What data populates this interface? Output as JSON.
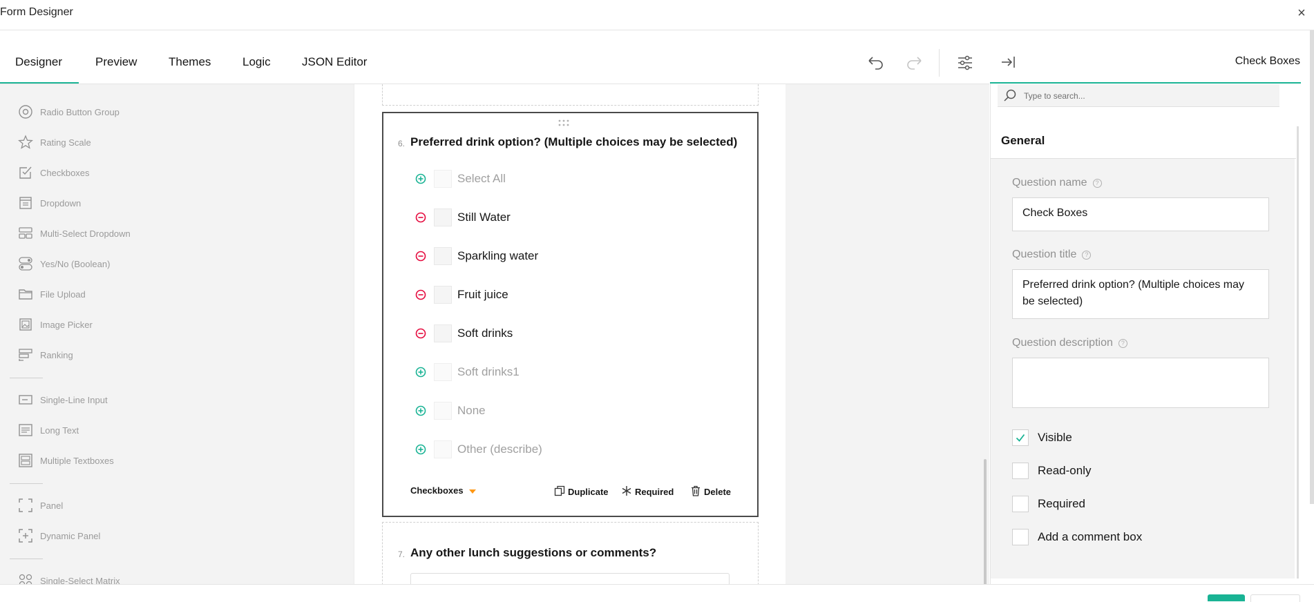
{
  "window": {
    "title": "Form Designer",
    "close_glyph": "×"
  },
  "tabs": [
    {
      "label": "Designer",
      "active": true
    },
    {
      "label": "Preview"
    },
    {
      "label": "Themes"
    },
    {
      "label": "Logic"
    },
    {
      "label": "JSON Editor"
    }
  ],
  "toolbar_icons": [
    "undo-icon",
    "redo-icon",
    "settings-sliders-icon"
  ],
  "toolbox": {
    "items": [
      {
        "label": "Radio Button Group",
        "icon": "radio-button-icon"
      },
      {
        "label": "Rating Scale",
        "icon": "star-icon"
      },
      {
        "label": "Checkboxes",
        "icon": "checkbox-icon"
      },
      {
        "label": "Dropdown",
        "icon": "dropdown-icon"
      },
      {
        "label": "Multi-Select Dropdown",
        "icon": "multi-select-icon"
      },
      {
        "label": "Yes/No (Boolean)",
        "icon": "toggle-icon"
      },
      {
        "label": "File Upload",
        "icon": "folder-icon"
      },
      {
        "label": "Image Picker",
        "icon": "image-icon"
      },
      {
        "label": "Ranking",
        "icon": "ranking-icon"
      },
      {
        "label": "Single-Line Input",
        "icon": "single-line-icon"
      },
      {
        "label": "Long Text",
        "icon": "long-text-icon"
      },
      {
        "label": "Multiple Textboxes",
        "icon": "multiple-textboxes-icon"
      },
      {
        "label": "Panel",
        "icon": "panel-icon"
      },
      {
        "label": "Dynamic Panel",
        "icon": "dynamic-panel-icon"
      },
      {
        "label": "Single-Select Matrix",
        "icon": "matrix-icon"
      }
    ]
  },
  "question6": {
    "number": "6.",
    "title": "Preferred drink option? (Multiple choices may be selected)",
    "choices": [
      {
        "label": "Select All",
        "state": "add"
      },
      {
        "label": "Still Water",
        "state": "remove"
      },
      {
        "label": "Sparkling water",
        "state": "remove"
      },
      {
        "label": "Fruit juice",
        "state": "remove"
      },
      {
        "label": "Soft drinks",
        "state": "remove"
      },
      {
        "label": "Soft drinks1",
        "state": "add"
      },
      {
        "label": "None",
        "state": "add"
      },
      {
        "label": "Other (describe)",
        "state": "add"
      }
    ],
    "footer": {
      "type_label": "Checkboxes",
      "duplicate": "Duplicate",
      "required": "Required",
      "delete": "Delete"
    }
  },
  "question7": {
    "number": "7.",
    "title": "Any other lunch suggestions or comments?"
  },
  "property_grid": {
    "selected_type": "Check Boxes",
    "search_placeholder": "Type to search...",
    "section": "General",
    "question_name_label": "Question name",
    "question_name_value": "Check Boxes",
    "question_title_label": "Question title",
    "question_title_value": "Preferred drink option? (Multiple choices may be selected)",
    "question_description_label": "Question description",
    "question_description_value": "",
    "checks": [
      {
        "label": "Visible",
        "checked": true
      },
      {
        "label": "Read-only",
        "checked": false
      },
      {
        "label": "Required",
        "checked": false
      },
      {
        "label": "Add a comment box",
        "checked": false
      }
    ]
  },
  "colors": {
    "accent": "#19b394",
    "remove": "#e50a3e",
    "footer_arrow": "#ff9814"
  }
}
